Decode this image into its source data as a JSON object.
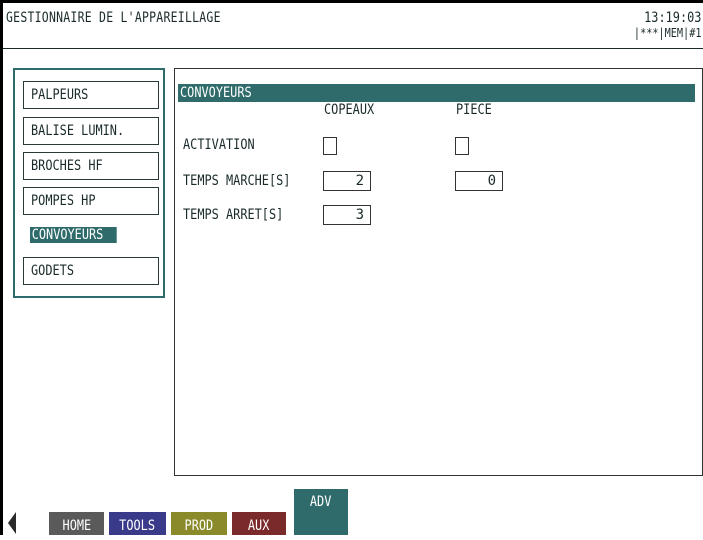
{
  "header": {
    "title": "GESTIONNAIRE DE L'APPAREILLAGE",
    "time": "13:19:03",
    "status": "|***|MEM|#1"
  },
  "menu": {
    "items": [
      {
        "label": "PALPEURS"
      },
      {
        "label": "BALISE LUMIN."
      },
      {
        "label": "BROCHES HF"
      },
      {
        "label": "POMPES HP"
      },
      {
        "label": "CONVOYEURS",
        "active": true
      },
      {
        "label": "GODETS"
      }
    ]
  },
  "section": {
    "title": "CONVOYEURS",
    "columns": [
      "COPEAUX",
      "PIECE"
    ],
    "rows": [
      {
        "label": "ACTIVATION",
        "copeaux_checked": false,
        "piece_checked": false
      },
      {
        "label": "TEMPS MARCHE[S]",
        "copeaux": "2",
        "piece": "0"
      },
      {
        "label": "TEMPS ARRET[S]",
        "copeaux": "3"
      }
    ]
  },
  "tabs": [
    {
      "label": "HOME",
      "color": "#5a5a5a"
    },
    {
      "label": "TOOLS",
      "color": "#3a3a8a"
    },
    {
      "label": "PROD",
      "color": "#8a8a2a"
    },
    {
      "label": "AUX",
      "color": "#7a2a2a"
    },
    {
      "label": "ADV",
      "color": "#2f6b6b",
      "active": true
    }
  ],
  "icons": {
    "nav_back": "left-arrow-icon"
  },
  "colors": {
    "accent": "#2f6b6b"
  }
}
